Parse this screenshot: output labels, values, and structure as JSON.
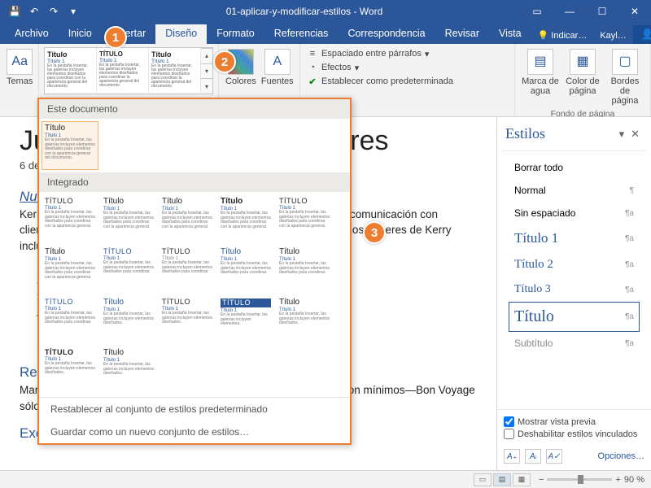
{
  "titlebar": {
    "title": "01-aplicar-y-modificar-estilos - Word"
  },
  "tabs": {
    "archivo": "Archivo",
    "inicio": "Inicio",
    "insertar": "Insertar",
    "diseno": "Diseño",
    "formato": "Formato",
    "referencias": "Referencias",
    "correspondencia": "Correspondencia",
    "revisar": "Revisar",
    "vista": "Vista",
    "tellme": "Indicar…",
    "user": "Kayl…",
    "share": "Compartir"
  },
  "ribbon": {
    "temas": "Temas",
    "colores": "Colores",
    "fuentes": "Fuentes",
    "espaciado": "Espaciado entre párrafos",
    "efectos": "Efectos",
    "predeterminada": "Establecer como predeterminada",
    "marca": "Marca de agua",
    "colorpag": "Color de página",
    "bordes": "Bordes de página",
    "fondo_group": "Fondo de página",
    "gallery_titulo": "Título"
  },
  "dropdown": {
    "sec1": "Este documento",
    "sec2": "Integrado",
    "titulo": "Título",
    "titulo_caps": "TÍTULO",
    "titulo1": "Título 1",
    "reset": "Restablecer al conjunto de estilos predeterminado",
    "save": "Guardar como un nuevo conjunto de estilos…"
  },
  "doc": {
    "h1": "Junta Trimestral de Directores",
    "date": "6 de abril",
    "h2a": "Nuevo capitán para Bon Voyage: Kerry Gold",
    "p1": "Kerry Gold ha sido reclutada como nueva capitana y dirigirá toda la comunicación con clientes … amplia experiencia … las ciencias, la mercadotecnia … Los deberes de Kerry incluirán:",
    "li1": "1.",
    "li2": "2.",
    "li3": "3.",
    "li4": "4.",
    "h2b": "Revisión del año que finalizó",
    "p2": "Marzo marcó … Bon Voyage. El Nuevo negocio … los retrasos fueron mínimos—Bon Voyage sólo recibió una queja de un cliente por un retraso.",
    "h2c": "Excursión Clásica a Las Vegas"
  },
  "styles": {
    "title": "Estilos",
    "borrar": "Borrar todo",
    "normal": "Normal",
    "sin": "Sin espaciado",
    "t1": "Título 1",
    "t2": "Título 2",
    "t3": "Título 3",
    "t": "Título",
    "sub": "Subtítulo",
    "preview": "Mostrar vista previa",
    "linked": "Deshabilitar estilos vinculados",
    "opciones": "Opciones…"
  },
  "status": {
    "zoom": "90 %"
  },
  "callouts": {
    "c1": "1",
    "c2": "2",
    "c3": "3"
  }
}
